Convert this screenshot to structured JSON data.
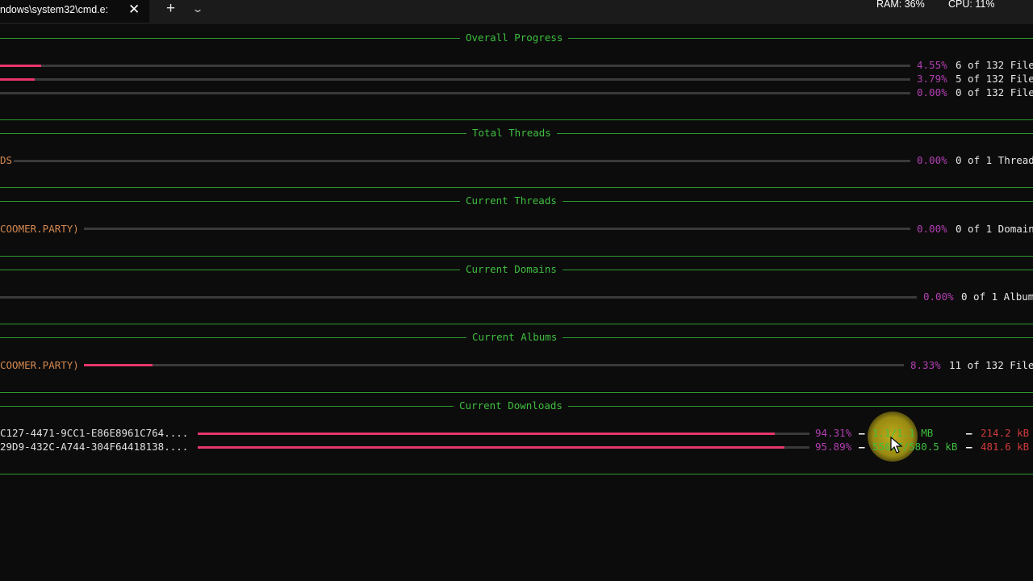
{
  "window": {
    "tab_title": "ndows\\system32\\cmd.e:",
    "close_glyph": "✕",
    "new_tab_glyph": "+",
    "dropdown_glyph": "⌄",
    "ram": "RAM: 36%",
    "cpu": "CPU: 11%"
  },
  "overall_progress": {
    "title": "Overall Progress",
    "rows": [
      {
        "pct": "4.55%",
        "count": "6 of 132 File",
        "fraction": 0.0455
      },
      {
        "pct": "3.79%",
        "count": "5 of 132 File",
        "fraction": 0.0379
      },
      {
        "pct": "0.00%",
        "count": "0 of 132 File",
        "fraction": 0
      }
    ]
  },
  "total_threads": {
    "title": "Total Threads",
    "label": "DS",
    "pct": "0.00%",
    "count": "0 of 1 Thread",
    "fraction": 0
  },
  "current_threads": {
    "title": "Current Threads",
    "label": "COOMER.PARTY)",
    "pct": "0.00%",
    "count": "0 of 1 Domain",
    "fraction": 0
  },
  "current_domains": {
    "title": "Current Domains",
    "pct": "0.00%",
    "count": "0 of 1 Album",
    "fraction": 0
  },
  "current_albums": {
    "title": "Current Albums",
    "label": "COOMER.PARTY)",
    "pct": "8.33%",
    "count": "11 of 132 File",
    "fraction": 0.0833
  },
  "current_downloads": {
    "title": "Current Downloads",
    "items": [
      {
        "name": "C127-4471-9CC1-E86E8961C764....",
        "pct": "94.31%",
        "size": "1.1/1.1 MB",
        "speed": "214.2 kB",
        "fraction": 0.9431
      },
      {
        "name": "29D9-432C-A744-304F64418138....",
        "pct": "95.89%",
        "size": "556.7/580.5 kB",
        "speed": "481.6 kB",
        "fraction": 0.9589
      }
    ]
  },
  "colors": {
    "section_green": "#3fbf3f",
    "progress_fill": "#e8356a",
    "percent_magenta": "#b33fb3",
    "speed_red": "#d23a3a"
  }
}
